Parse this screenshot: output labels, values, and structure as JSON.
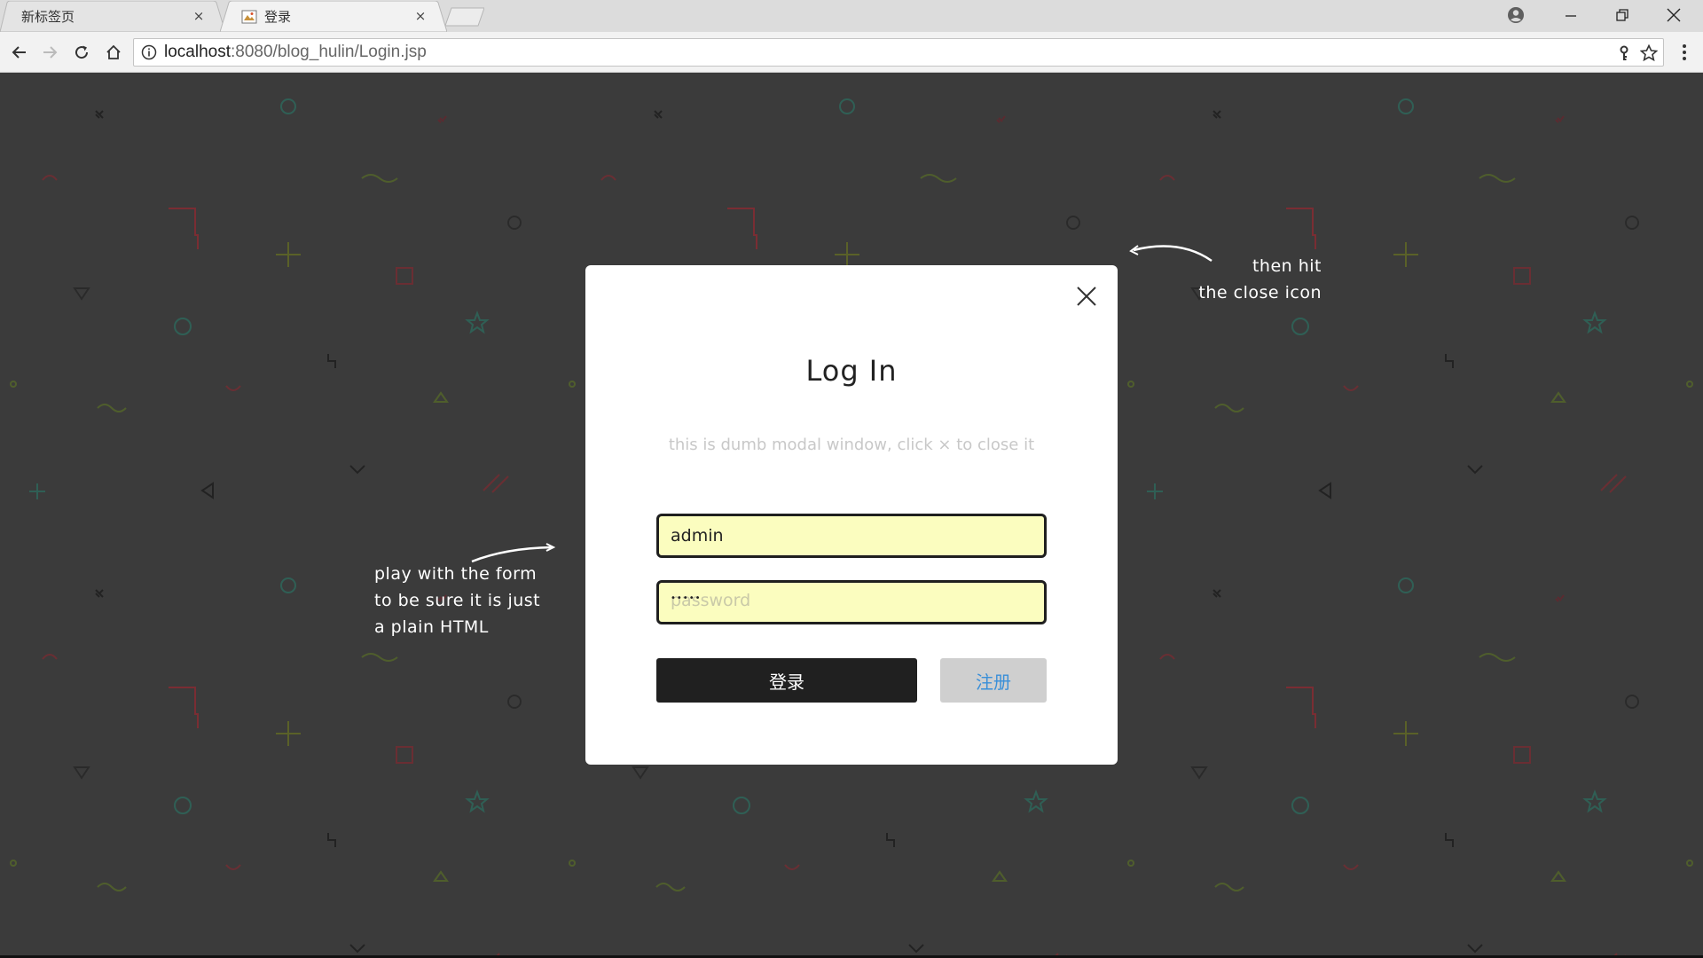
{
  "browser": {
    "tabs": [
      {
        "title": "新标签页",
        "close": "×",
        "active": false
      },
      {
        "title": "登录",
        "close": "×",
        "active": true
      }
    ],
    "url_host": "localhost",
    "url_rest": ":8080/blog_hulin/Login.jsp"
  },
  "modal": {
    "close_symbol": "×",
    "title": "Log In",
    "description": "this is dumb modal window, click × to close it",
    "username_value": "admin",
    "password_placeholder": "password",
    "password_masked": "•••••",
    "login_button": "登录",
    "register_button": "注册"
  },
  "hints": {
    "left": [
      "play with the form",
      "to be sure it is just",
      "a plain HTML"
    ],
    "right": [
      "then hit",
      "the close icon"
    ]
  },
  "colors": {
    "page_background": "#3b3b3b",
    "field_background": "#fbfdbf",
    "login_button": "#202020",
    "register_button_bg": "#cfcfcf",
    "register_button_text": "#3a8fd8"
  }
}
